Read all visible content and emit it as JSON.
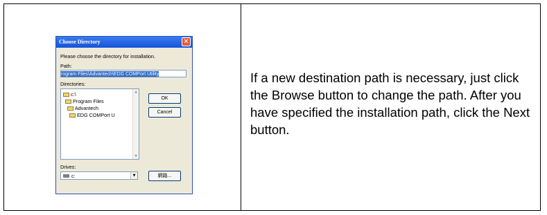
{
  "instruction_text": "If a new destination path is necessary, just click the Browse button to change the path. After you have specified the installation path, click the Next button.",
  "dialog": {
    "title": "Choose Directory",
    "close_glyph": "✕",
    "prompt": "Please choose the directory for installation.",
    "path_label": "Path:",
    "path_value": "rogram Files\\Advantech\\EDG COMPort Utility",
    "directories_label": "Directories:",
    "directories": [
      "c:\\",
      "Program Files",
      "Advantech",
      "EDG COMPort U"
    ],
    "scroll_up_glyph": "▲",
    "scroll_down_glyph": "▼",
    "ok_label": "OK",
    "cancel_label": "Cancel",
    "drives_label": "Drives:",
    "drive_value": "c:",
    "drive_arrow_glyph": "▼",
    "network_label": "網路..."
  }
}
